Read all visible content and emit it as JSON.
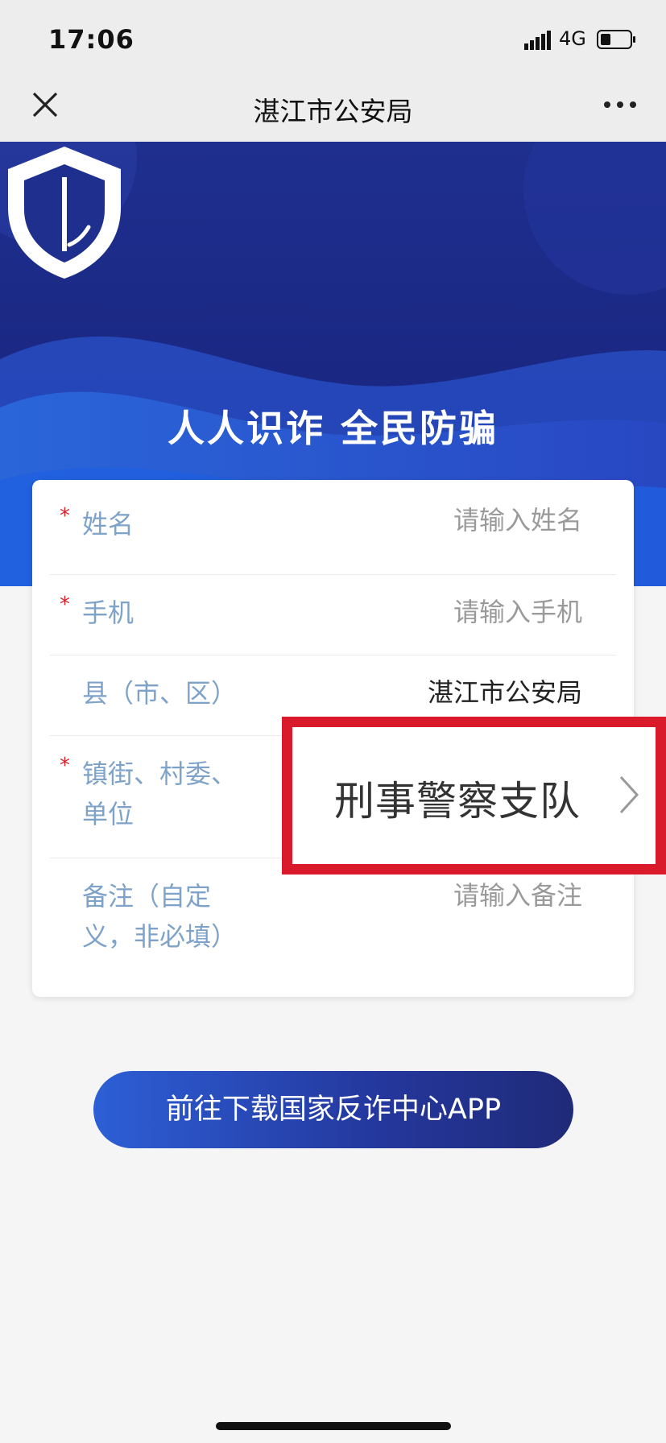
{
  "status_bar": {
    "time": "17:06",
    "network": "4G"
  },
  "nav": {
    "title": "湛江市公安局"
  },
  "banner": {
    "slogan": "人人识诈 全民防骗"
  },
  "form": {
    "rows": [
      {
        "label": "姓名",
        "required": "*",
        "placeholder": "请输入姓名"
      },
      {
        "label": "手机",
        "required": "*",
        "placeholder": "请输入手机"
      },
      {
        "label": "县（市、区）",
        "value": "湛江市公安局"
      },
      {
        "label_line1": "镇街、村委、",
        "label_line2": "单位",
        "required": "*"
      },
      {
        "label_line1": "备注（自定",
        "label_line2": "义，非必填）",
        "placeholder": "请输入备注"
      }
    ]
  },
  "highlight": {
    "selected_value": "刑事警察支队"
  },
  "download_button": {
    "label": "前往下载国家反诈中心APP"
  },
  "colors": {
    "banner_dark": "#1b2a86",
    "banner_wave": "#2a5bd7",
    "label_blue": "#7ea2c8",
    "required_red": "#d8242c",
    "highlight_red": "#d91a2a"
  }
}
